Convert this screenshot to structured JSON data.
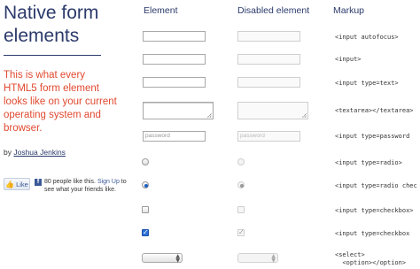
{
  "header": {
    "title": "Native form elements",
    "intro": "This is what every HTML5 form element looks like on your current operating system and browser.",
    "byline_prefix": "by ",
    "author": "Joshua Jenkins"
  },
  "facebook": {
    "like_label": "Like",
    "count_text": "80 people like this.",
    "signup_label": "Sign Up",
    "signup_suffix": " to see what your friends like."
  },
  "columns": {
    "element": "Element",
    "disabled": "Disabled element",
    "markup": "Markup"
  },
  "rows": [
    {
      "type": "text",
      "markup": "<input autofocus>"
    },
    {
      "type": "text",
      "markup": "<input>"
    },
    {
      "type": "text",
      "markup": "<input type=text>"
    },
    {
      "type": "textarea",
      "markup": "<textarea></textarea>"
    },
    {
      "type": "password",
      "placeholder": "password",
      "markup": "<input type=password"
    },
    {
      "type": "radio",
      "checked": false,
      "markup": "<input type=radio>"
    },
    {
      "type": "radio",
      "checked": true,
      "markup": "<input type=radio chec"
    },
    {
      "type": "checkbox",
      "checked": false,
      "markup": "<input type=checkbox>"
    },
    {
      "type": "checkbox",
      "checked": true,
      "markup": "<input type=checkbox"
    },
    {
      "type": "select",
      "markup": "<select>\n  <option></option>"
    }
  ]
}
